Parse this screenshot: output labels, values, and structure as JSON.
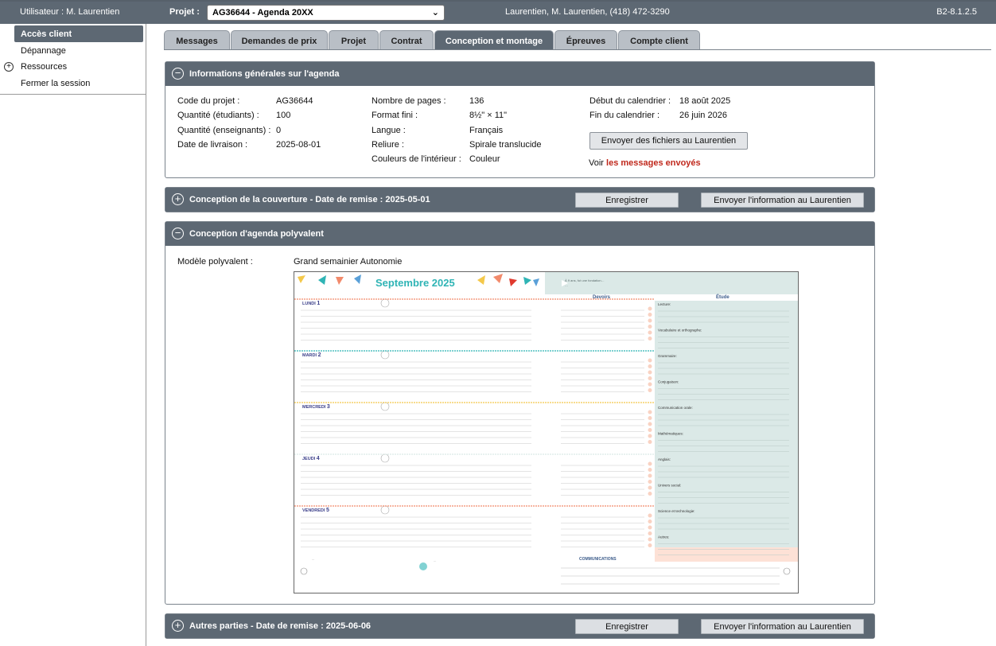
{
  "topbar": {
    "user": "Utilisateur : M. Laurentien",
    "project_label": "Projet :",
    "project_value": "AG36644 - Agenda 20XX",
    "contact": "Laurentien,  M. Laurentien,  (418) 472-3290",
    "version": "B2-8.1.2.5"
  },
  "sidebar": {
    "items": [
      {
        "label": "Accès client"
      },
      {
        "label": "Dépannage"
      },
      {
        "label": "Ressources"
      },
      {
        "label": "Fermer la session"
      }
    ]
  },
  "tabs": [
    {
      "label": "Messages"
    },
    {
      "label": "Demandes de prix"
    },
    {
      "label": "Projet"
    },
    {
      "label": "Contrat"
    },
    {
      "label": "Conception et montage"
    },
    {
      "label": "Épreuves"
    },
    {
      "label": "Compte client"
    }
  ],
  "info": {
    "title": "Informations générales sur l'agenda",
    "col1": [
      {
        "label": "Code du projet :",
        "value": "AG36644"
      },
      {
        "label": "Quantité (étudiants) :",
        "value": "100"
      },
      {
        "label": "Quantité (enseignants) :",
        "value": "0"
      },
      {
        "label": "Date de livraison :",
        "value": "2025-08-01"
      }
    ],
    "col2": [
      {
        "label": "Nombre de pages :",
        "value": "136"
      },
      {
        "label": "Format fini :",
        "value": "8½\" × 11\""
      },
      {
        "label": "Langue :",
        "value": "Français"
      },
      {
        "label": "Reliure :",
        "value": "Spirale translucide"
      },
      {
        "label": "Couleurs de l'intérieur :",
        "value": "Couleur"
      }
    ],
    "col3": [
      {
        "label": "Début du calendrier :",
        "value": "18 août 2025"
      },
      {
        "label": "Fin du calendrier :",
        "value": "26 juin 2026"
      }
    ],
    "send_button": "Envoyer des fichiers au Laurentien",
    "voir_prefix": "Voir ",
    "voir_link": "les messages envoyés"
  },
  "cover": {
    "title": "Conception de la couverture - Date de remise : 2025-05-01",
    "save": "Enregistrer",
    "send": "Envoyer l'information au Laurentien"
  },
  "poly": {
    "title": "Conception d'agenda polyvalent",
    "model_label": "Modèle polyvalent :",
    "model_value": "Grand semainier Autonomie",
    "preview": {
      "month": "Septembre 2025",
      "days": [
        {
          "name": "LUNDI",
          "num": "1"
        },
        {
          "name": "MARDI",
          "num": "2"
        },
        {
          "name": "MERCREDI",
          "num": "3"
        },
        {
          "name": "JEUDI",
          "num": "4"
        },
        {
          "name": "VENDREDI",
          "num": "5"
        }
      ],
      "devoirs": "Devoirs",
      "etude": "Étude",
      "subjects": [
        "Lecture:",
        "Vocabulaire et orthographe:",
        "Grammaire:",
        "Conjugaison:",
        "Communication orale:",
        "Mathématiques:",
        "Anglais:",
        "Univers social:",
        "Science et technologie:",
        "Autres:"
      ],
      "communications": "COMMUNICATIONS",
      "colors": {
        "teal": "#2fb4b5",
        "coral": "#f28a6b",
        "yellow": "#f4c84a",
        "blue": "#5aa0d8",
        "mint": "#dbe9e7"
      }
    }
  },
  "other": {
    "title": "Autres parties - Date de remise : 2025-06-06",
    "save": "Enregistrer",
    "send": "Envoyer l'information au Laurentien"
  }
}
